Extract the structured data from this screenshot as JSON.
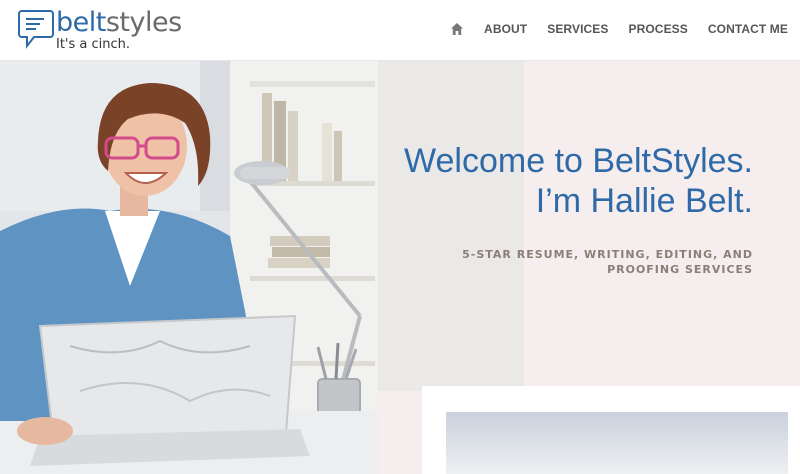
{
  "logo": {
    "word_main": "belt",
    "word_accent": "styles",
    "tagline": "It's a cinch."
  },
  "nav": {
    "home_icon": "home-icon",
    "items": [
      {
        "label": "ABOUT"
      },
      {
        "label": "SERVICES"
      },
      {
        "label": "PROCESS"
      },
      {
        "label": "CONTACT ME"
      }
    ]
  },
  "hero": {
    "title_line1": "Welcome to BeltStyles.",
    "title_line2": "I’m Hallie Belt.",
    "subtitle": "5-STAR RESUME, WRITING, EDITING, AND PROOFING SERVICES"
  },
  "colors": {
    "brand_blue": "#2f6aa8",
    "nav_text": "#555555",
    "subtitle": "#8a7f77",
    "hero_bg": "#f6eeee"
  }
}
